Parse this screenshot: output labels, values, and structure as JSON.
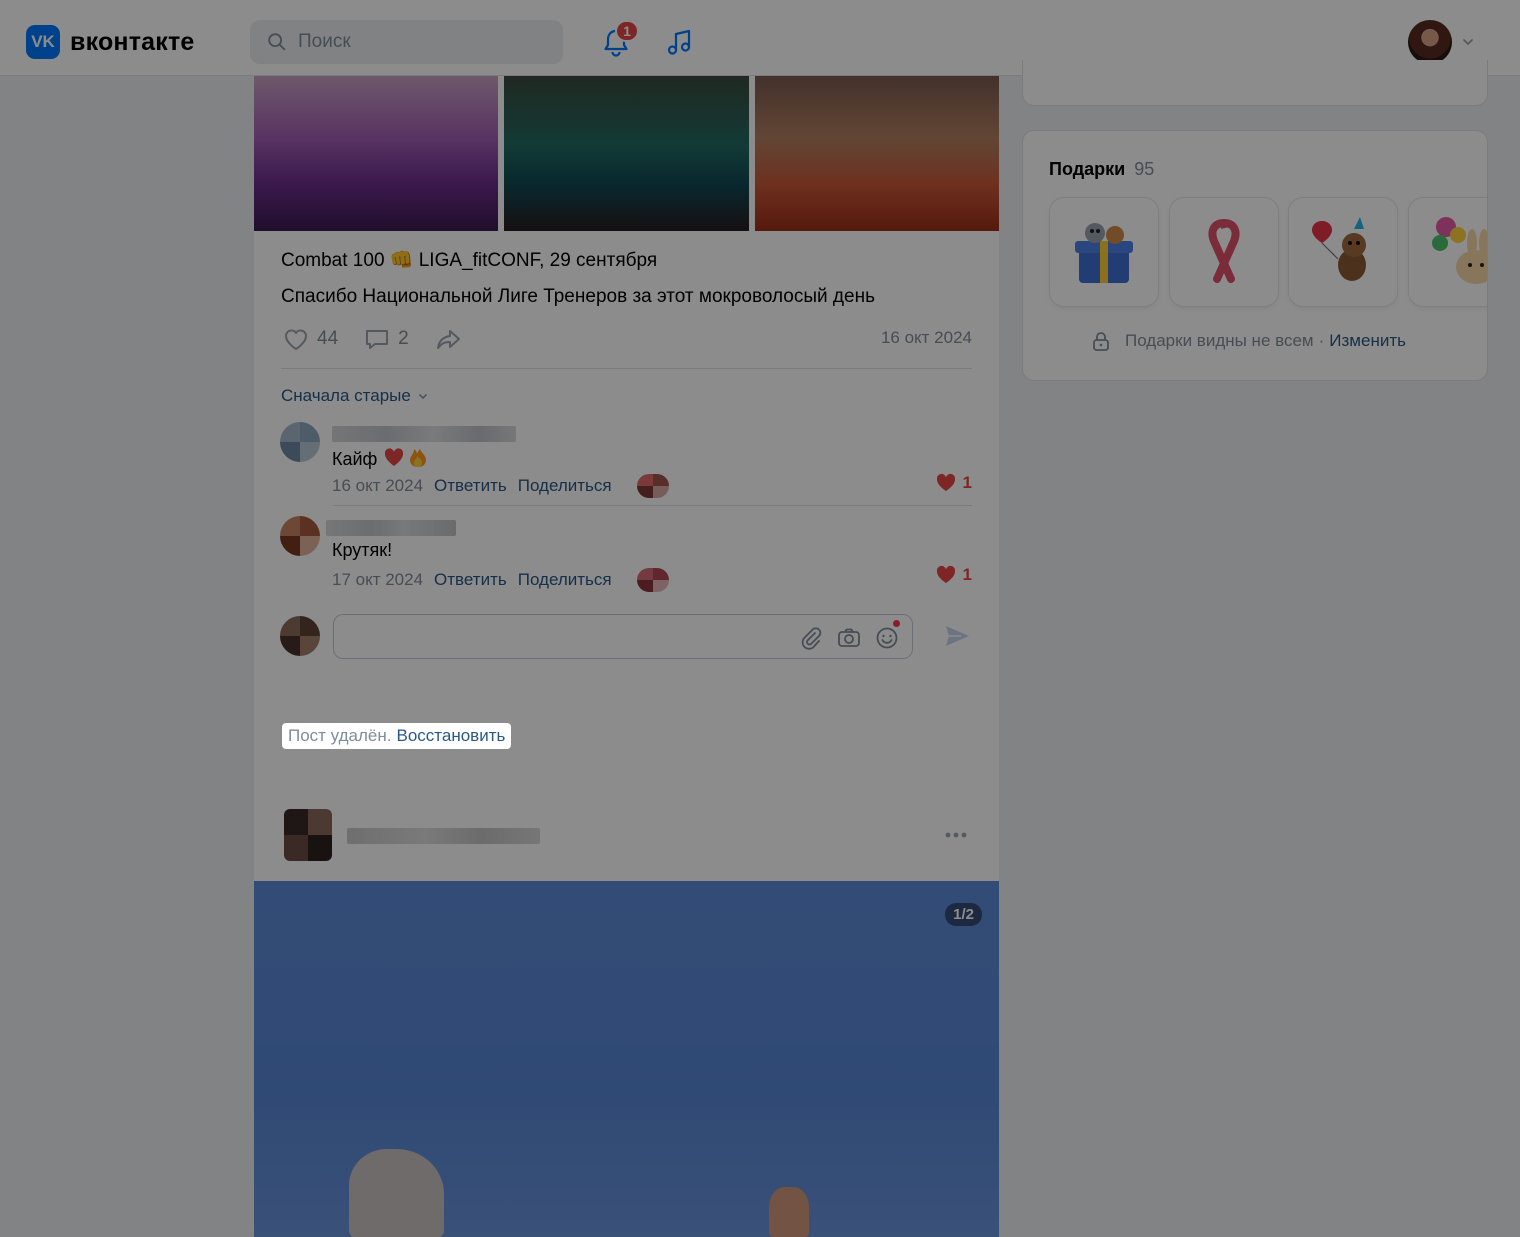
{
  "header": {
    "logo_mark": "VK",
    "logo_text": "вконтакте",
    "search_placeholder": "Поиск",
    "notifications_count": "1"
  },
  "post": {
    "title": "Combat 100 👊 LIGA_fitCONF, 29 сентября",
    "text": "Спасибо Национальной Лиге Тренеров за этот мокроволосый день",
    "likes": "44",
    "comments": "2",
    "date": "16 окт 2024"
  },
  "comments_section": {
    "sort_label": "Сначала старые",
    "items": [
      {
        "text": "Кайф",
        "emoji": "❤️‍🔥",
        "date": "16 окт 2024",
        "reply_label": "Ответить",
        "share_label": "Поделиться",
        "likes": "1"
      },
      {
        "text": "Крутяк!",
        "emoji": "",
        "date": "17 окт 2024",
        "reply_label": "Ответить",
        "share_label": "Поделиться",
        "likes": "1"
      }
    ]
  },
  "deleted_notice": {
    "text": "Пост удалён.",
    "restore_label": "Восстановить"
  },
  "next_post": {
    "photo_counter": "1/2"
  },
  "gifts": {
    "title": "Подарки",
    "count": "95",
    "note": "Подарки видны не всем",
    "separator": "·",
    "change_label": "Изменить",
    "items": [
      "gift-box-icon",
      "ribbon-icon",
      "dog-balloon-icon",
      "bunny-balloons-icon"
    ]
  },
  "colors": {
    "accent": "#0077ff",
    "link": "#2a5885",
    "muted": "#818c99",
    "like_red": "#e64646",
    "overlay": "rgba(0,0,0,0.45)"
  }
}
